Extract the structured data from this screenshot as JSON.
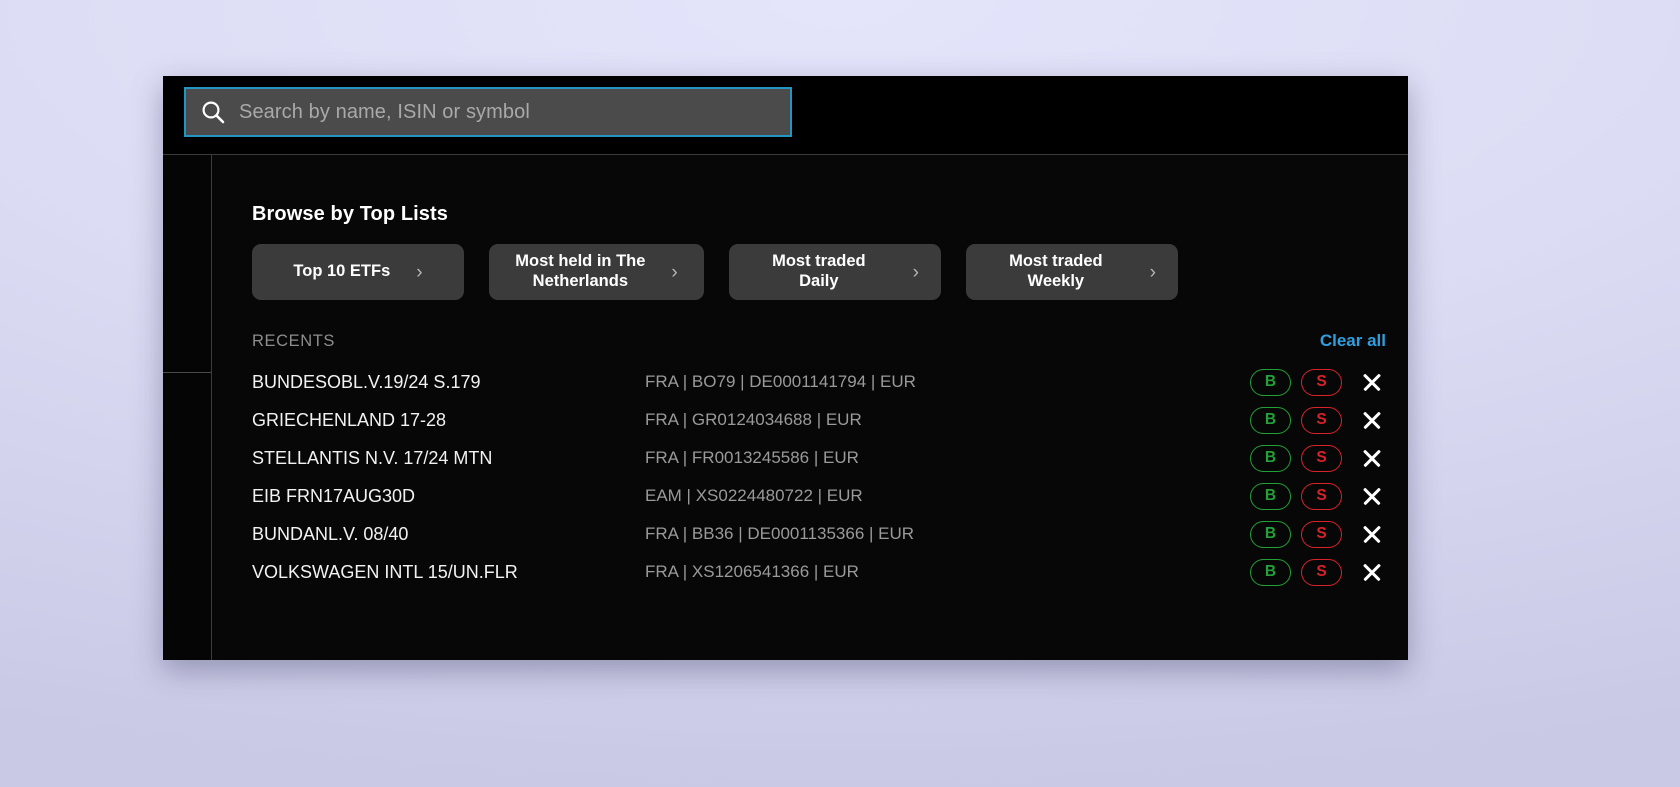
{
  "search": {
    "placeholder": "Search by name, ISIN or symbol",
    "value": "",
    "icon": "search-icon"
  },
  "browse": {
    "title": "Browse by Top Lists",
    "chips": [
      {
        "label": "Top 10 ETFs",
        "arrow": "›"
      },
      {
        "label": "Most held in The\nNetherlands",
        "arrow": "›"
      },
      {
        "label": "Most traded Daily",
        "arrow": "›"
      },
      {
        "label": "Most traded Weekly",
        "arrow": "›"
      }
    ]
  },
  "recents": {
    "label": "RECENTS",
    "clear_all_label": "Clear all",
    "buy_label": "B",
    "sell_label": "S",
    "close_icon": "close-icon",
    "rows": [
      {
        "name": "BUNDESOBL.V.19/24 S.179",
        "meta": "FRA | BO79 | DE0001141794 | EUR"
      },
      {
        "name": "GRIECHENLAND 17-28",
        "meta": "FRA | GR0124034688 | EUR"
      },
      {
        "name": "STELLANTIS N.V. 17/24 MTN",
        "meta": "FRA | FR0013245586 | EUR"
      },
      {
        "name": "EIB FRN17AUG30D",
        "meta": "EAM | XS0224480722 | EUR"
      },
      {
        "name": "BUNDANL.V. 08/40",
        "meta": "FRA | BB36 | DE0001135366 | EUR"
      },
      {
        "name": "VOLKSWAGEN INTL 15/UN.FLR",
        "meta": "FRA | XS1206541366 | EUR"
      }
    ]
  },
  "colors": {
    "accent_blue": "#2f9fe0",
    "search_border": "#2196c4",
    "buy_green": "#23a037",
    "sell_red": "#d8232a",
    "panel_bg": "#060606",
    "chip_bg": "#3b3b3b",
    "page_bg": "#dcdcf5"
  }
}
